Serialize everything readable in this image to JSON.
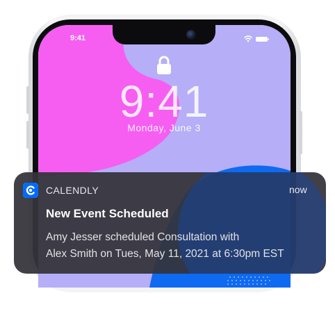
{
  "status_bar": {
    "time": "9:41",
    "icons": [
      "wifi-icon",
      "battery-icon"
    ]
  },
  "lock_screen": {
    "lock_icon": "lock-icon",
    "clock": "9:41",
    "date": "Monday, June 3"
  },
  "notification": {
    "app_icon": "calendly-logo-icon",
    "app_name": "CALENDLY",
    "time": "now",
    "title": "New Event Scheduled",
    "body_line_1": "Amy Jesser scheduled Consultation with",
    "body_line_2": "Alex Smith on Tues, May 11, 2021 at 6:30pm EST"
  },
  "colors": {
    "wallpaper_lavender": "#b6aef7",
    "wallpaper_magenta": "#f65ef2",
    "wallpaper_blue": "#0e6af0",
    "brand": "#006bff",
    "notification_bg": "#34343a"
  }
}
